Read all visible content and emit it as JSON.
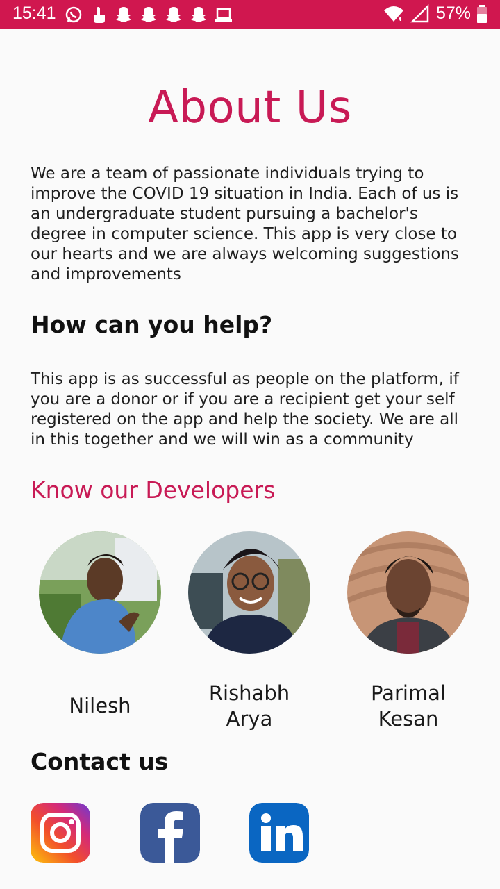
{
  "status_bar": {
    "time": "15:41",
    "battery": "57%",
    "background": "#d0174f",
    "notification_icons": [
      "whatsapp-icon",
      "touch-icon",
      "snapchat-icon",
      "snapchat-icon",
      "snapchat-icon",
      "snapchat-icon",
      "laptop-icon"
    ],
    "system_icons": [
      "wifi-icon",
      "signal-icon",
      "battery-icon"
    ]
  },
  "page": {
    "title": "About Us",
    "accent_color": "#c81a55",
    "intro": "We are a team of passionate individuals trying to improve the COVID 19 situation in India. Each of us is an undergraduate student pursuing a bachelor's degree in computer science. This app is very close to our hearts and we are always welcoming suggestions and improvements",
    "help_heading": "How can you help?",
    "help_text": "This app is as successful as people on the platform, if you are a donor or if you are a recipient get your self registered on the app and help the society. We are all in this together and we will win as a community",
    "developers_heading": "Know our Developers",
    "developers": [
      {
        "first": "Nilesh",
        "last": ""
      },
      {
        "first": "Rishabh",
        "last": "Arya"
      },
      {
        "first": "Parimal",
        "last": "Kesan"
      }
    ],
    "contact_heading": "Contact us",
    "social": [
      {
        "name": "instagram-icon"
      },
      {
        "name": "facebook-icon"
      },
      {
        "name": "linkedin-icon"
      }
    ]
  }
}
